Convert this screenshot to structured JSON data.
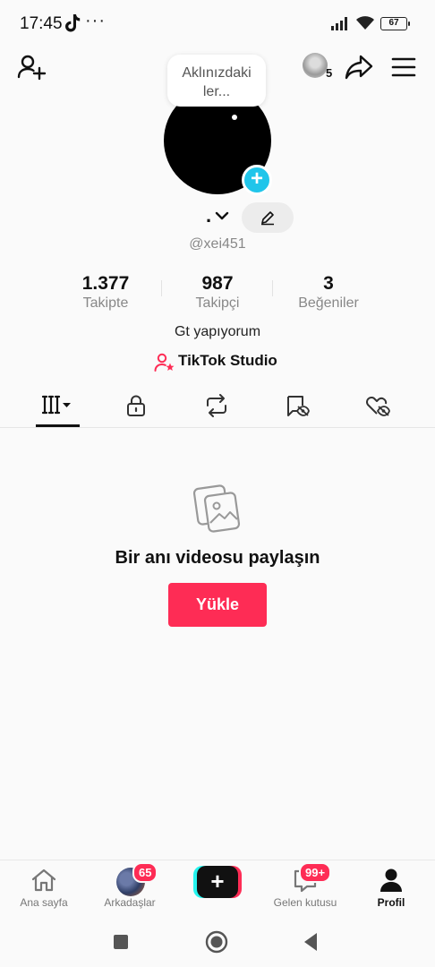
{
  "status_bar": {
    "time": "17:45",
    "more_dots": "···",
    "battery": "67"
  },
  "top_bar": {
    "viewers_count": "5"
  },
  "profile": {
    "thought_bubble": "Aklınızdaki ler...",
    "display_name": ".",
    "username": "@xei451",
    "bio": "Gt yapıyorum",
    "studio_label": "TikTok Studio"
  },
  "stats": [
    {
      "value": "1.377",
      "label": "Takipte"
    },
    {
      "value": "987",
      "label": "Takipçi"
    },
    {
      "value": "3",
      "label": "Beğeniler"
    }
  ],
  "tabs": [
    {
      "icon": "videos-grid-icon",
      "active": true
    },
    {
      "icon": "lock-icon",
      "active": false
    },
    {
      "icon": "repost-icon",
      "active": false
    },
    {
      "icon": "favorites-hidden-icon",
      "active": false
    },
    {
      "icon": "liked-hidden-icon",
      "active": false
    }
  ],
  "empty_state": {
    "title": "Bir anı videosu paylaşın",
    "upload_label": "Yükle"
  },
  "bottom_nav": {
    "home_label": "Ana sayfa",
    "friends_label": "Arkadaşlar",
    "friends_badge": "65",
    "create_label": "+",
    "inbox_label": "Gelen kutusu",
    "inbox_badge": "99+",
    "profile_label": "Profil"
  },
  "colors": {
    "accent": "#fe2c55",
    "cyan": "#25f4ee",
    "avatar_add": "#20c5ea"
  }
}
